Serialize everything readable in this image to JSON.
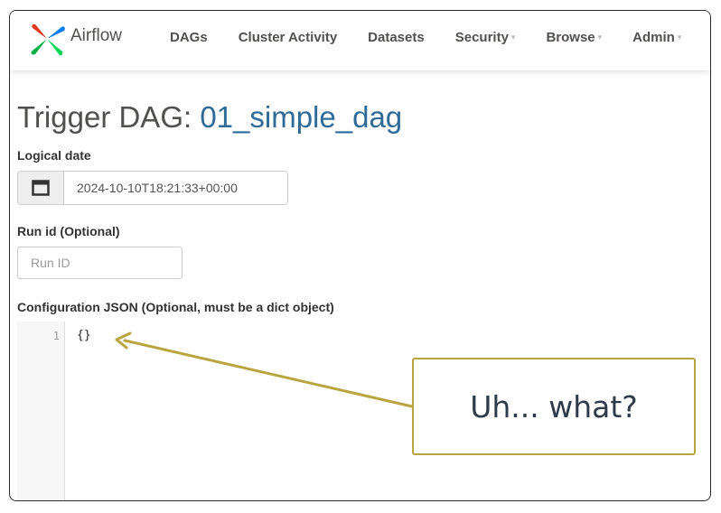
{
  "brand": {
    "name": "Airflow"
  },
  "nav": {
    "items": [
      {
        "label": "DAGs",
        "dropdown": false
      },
      {
        "label": "Cluster Activity",
        "dropdown": false
      },
      {
        "label": "Datasets",
        "dropdown": false
      },
      {
        "label": "Security",
        "dropdown": true
      },
      {
        "label": "Browse",
        "dropdown": true
      },
      {
        "label": "Admin",
        "dropdown": true
      }
    ]
  },
  "page": {
    "title_prefix": "Trigger DAG: ",
    "dag_id": "01_simple_dag"
  },
  "form": {
    "logical_date_label": "Logical date",
    "logical_date_value": "2024-10-10T18:21:33+00:00",
    "calendar_icon": "calendar-icon",
    "run_id_label": "Run id (Optional)",
    "run_id_placeholder": "Run ID",
    "config_label": "Configuration JSON (Optional, must be a dict object)",
    "config_line_number": "1",
    "config_value": "{}"
  },
  "annotation": {
    "text": "Uh... what?"
  },
  "colors": {
    "accent_link": "#2e6b99",
    "callout_border": "#b9a540",
    "nav_text": "#51504f"
  }
}
